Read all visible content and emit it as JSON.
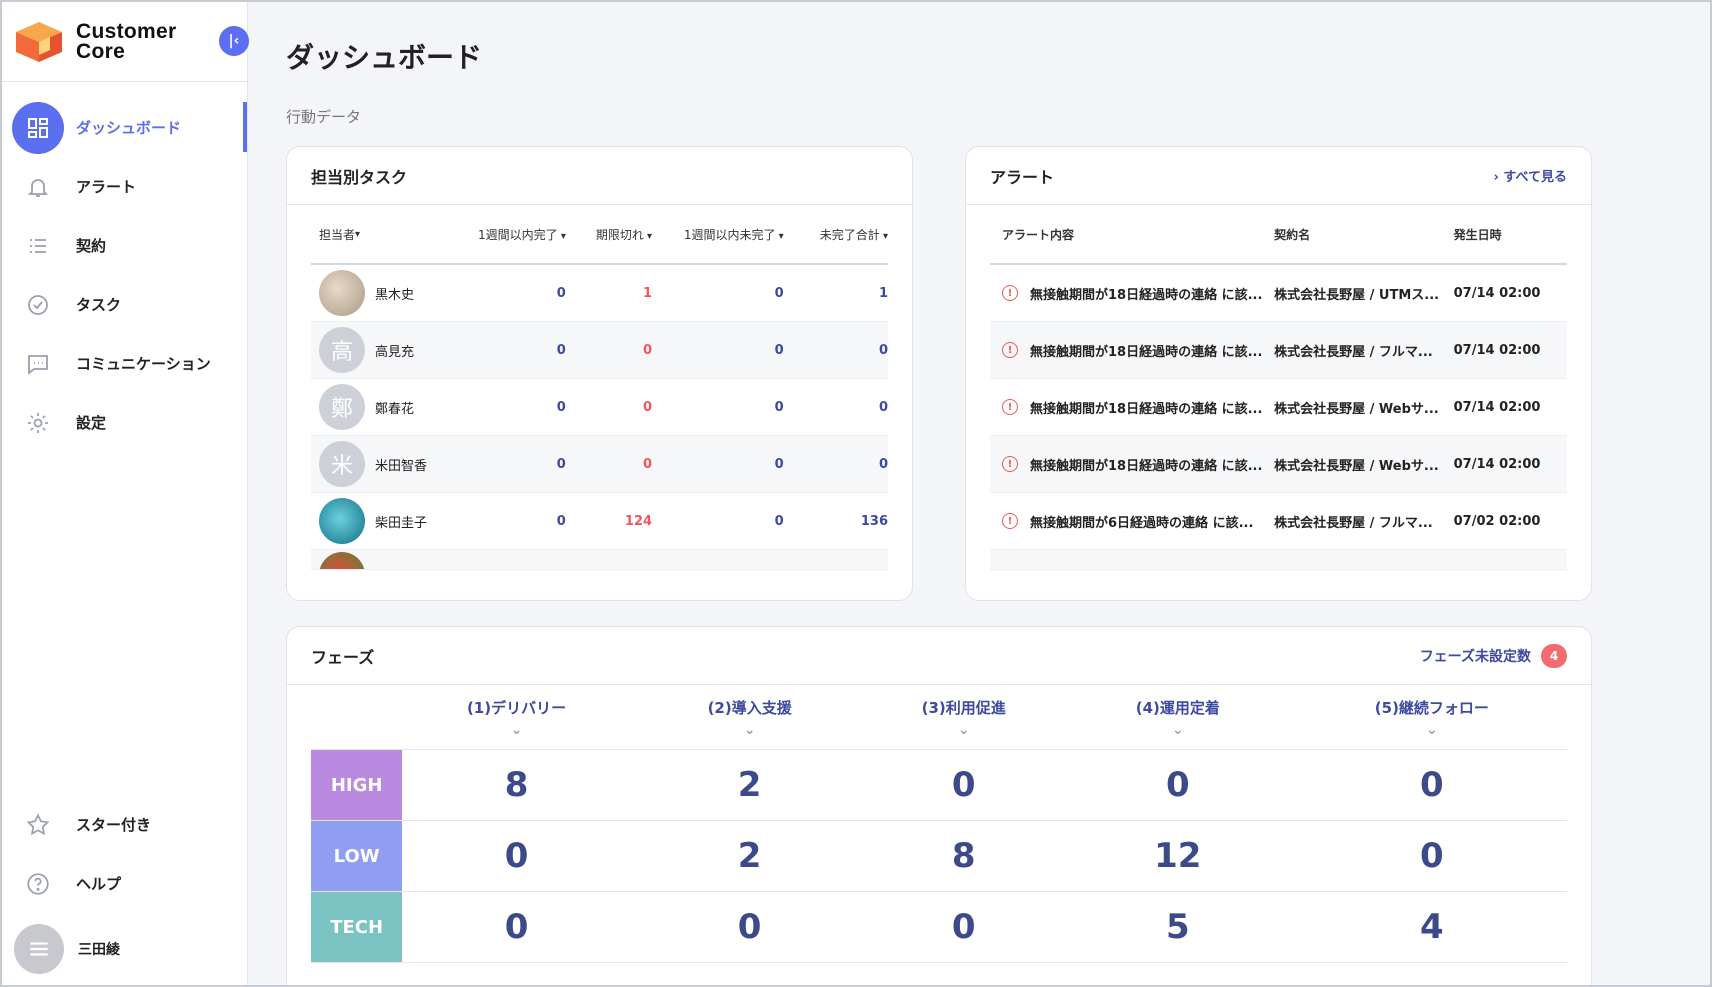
{
  "brand": {
    "line1": "Customer",
    "line2": "Core"
  },
  "sidebar": {
    "items": [
      {
        "label": "ダッシュボード",
        "icon": "dashboard-icon",
        "active": true
      },
      {
        "label": "アラート",
        "icon": "bell-icon"
      },
      {
        "label": "契約",
        "icon": "list-icon"
      },
      {
        "label": "タスク",
        "icon": "check-circle-icon"
      },
      {
        "label": "コミュニケーション",
        "icon": "chat-icon"
      },
      {
        "label": "設定",
        "icon": "gear-icon"
      }
    ],
    "bottom": [
      {
        "label": "スター付き",
        "icon": "star-icon"
      },
      {
        "label": "ヘルプ",
        "icon": "help-icon"
      }
    ],
    "user": {
      "name": "三田綾"
    }
  },
  "page": {
    "title": "ダッシュボード",
    "section": "行動データ"
  },
  "tasks": {
    "title": "担当別タスク",
    "headers": [
      "担当者",
      "1週間以内完了",
      "期限切れ",
      "1週間以内未完了",
      "未完了合計"
    ],
    "rows": [
      {
        "name": "黒木史",
        "avatar": "",
        "c1": "0",
        "c2": "1",
        "c3": "0",
        "c4": "1"
      },
      {
        "name": "高見充",
        "avatar": "高",
        "c1": "0",
        "c2": "0",
        "c3": "0",
        "c4": "0"
      },
      {
        "name": "鄭春花",
        "avatar": "鄭",
        "c1": "0",
        "c2": "0",
        "c3": "0",
        "c4": "0"
      },
      {
        "name": "米田智香",
        "avatar": "米",
        "c1": "0",
        "c2": "0",
        "c3": "0",
        "c4": "0"
      },
      {
        "name": "柴田圭子",
        "avatar": "",
        "c1": "0",
        "c2": "124",
        "c3": "0",
        "c4": "136"
      }
    ]
  },
  "alerts": {
    "title": "アラート",
    "see_all": "› すべて見る",
    "headers": [
      "アラート内容",
      "契約名",
      "発生日時"
    ],
    "rows": [
      {
        "content": "無接触期間が18日経過時の連絡 に該...",
        "contract": "株式会社長野屋 / UTMス...",
        "time": "07/14 02:00"
      },
      {
        "content": "無接触期間が18日経過時の連絡 に該...",
        "contract": "株式会社長野屋 / フルマ...",
        "time": "07/14 02:00"
      },
      {
        "content": "無接触期間が18日経過時の連絡 に該...",
        "contract": "株式会社長野屋 / Webサ...",
        "time": "07/14 02:00"
      },
      {
        "content": "無接触期間が18日経過時の連絡 に該...",
        "contract": "株式会社長野屋 / Webサ...",
        "time": "07/14 02:00"
      },
      {
        "content": "無接触期間が6日経過時の連絡 に該...",
        "contract": "株式会社長野屋 / フルマ...",
        "time": "07/02 02:00"
      }
    ]
  },
  "phases": {
    "title": "フェーズ",
    "unset_label": "フェーズ未設定数",
    "unset_count": "4",
    "columns": [
      "(1)デリバリー",
      "(2)導入支援",
      "(3)利用促進",
      "(4)運用定着",
      "(5)継続フォロー"
    ],
    "rows": [
      {
        "tag": "HIGH",
        "values": [
          "8",
          "2",
          "0",
          "0",
          "0"
        ]
      },
      {
        "tag": "LOW",
        "values": [
          "0",
          "2",
          "8",
          "12",
          "0"
        ]
      },
      {
        "tag": "TECH",
        "values": [
          "0",
          "0",
          "0",
          "5",
          "4"
        ]
      }
    ]
  },
  "colors": {
    "accent": "#5b6ff0",
    "danger": "#f0565a",
    "high": "#b98ae0",
    "low": "#8f9df3",
    "tech": "#7bc2c2"
  }
}
